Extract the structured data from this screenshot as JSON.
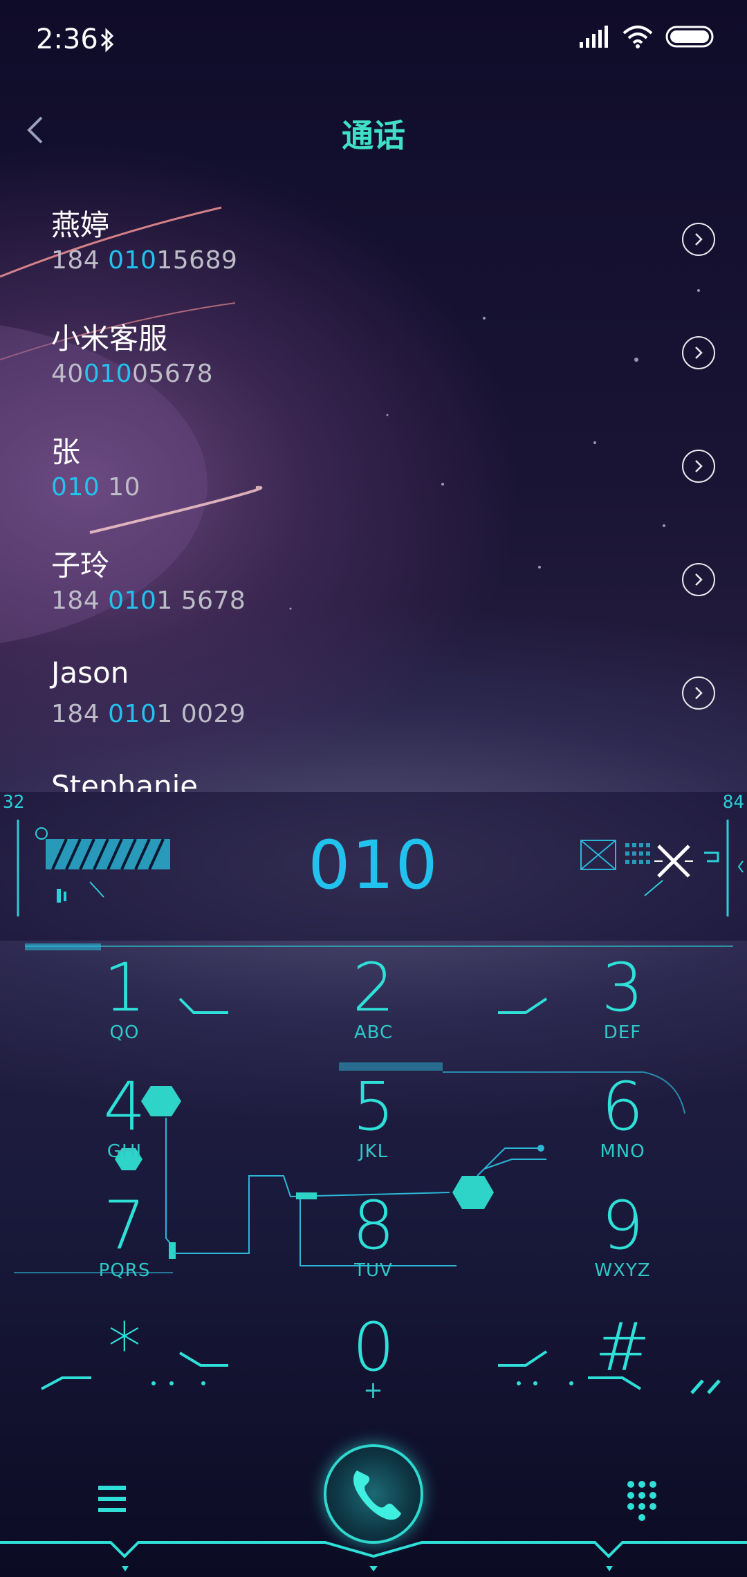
{
  "status_bar": {
    "time": "2:36"
  },
  "header": {
    "title": "通话"
  },
  "calls": [
    {
      "name": "燕婷",
      "number": [
        {
          "t": "184 ",
          "h": false
        },
        {
          "t": "010",
          "h": true
        },
        {
          "t": "15689",
          "h": false
        }
      ]
    },
    {
      "name": "小米客服",
      "number": [
        {
          "t": "40",
          "h": false
        },
        {
          "t": "010",
          "h": true
        },
        {
          "t": "05678",
          "h": false
        }
      ]
    },
    {
      "name": "张",
      "number": [
        {
          "t": "010",
          "h": true
        },
        {
          "t": " 10",
          "h": false
        }
      ]
    },
    {
      "name": "子玲",
      "number": [
        {
          "t": "184 ",
          "h": false
        },
        {
          "t": "010",
          "h": true
        },
        {
          "t": "1 5678",
          "h": false
        }
      ]
    },
    {
      "name": "Jason",
      "number": [
        {
          "t": "184 ",
          "h": false
        },
        {
          "t": "010",
          "h": true
        },
        {
          "t": "1 0029",
          "h": false
        }
      ]
    },
    {
      "name": "Stephanie",
      "number": []
    }
  ],
  "dialer": {
    "number": "010",
    "corner_left": "32",
    "corner_right": "84"
  },
  "keypad": [
    {
      "digit": "1",
      "letters": "QO"
    },
    {
      "digit": "2",
      "letters": "ABC"
    },
    {
      "digit": "3",
      "letters": "DEF"
    },
    {
      "digit": "4",
      "letters": "GHI"
    },
    {
      "digit": "5",
      "letters": "JKL"
    },
    {
      "digit": "6",
      "letters": "MNO"
    },
    {
      "digit": "7",
      "letters": "PQRS"
    },
    {
      "digit": "8",
      "letters": "TUV"
    },
    {
      "digit": "9",
      "letters": "WXYZ"
    },
    {
      "digit": "*",
      "letters": ""
    },
    {
      "digit": "0",
      "letters": "+"
    },
    {
      "digit": "#",
      "letters": ""
    }
  ],
  "colors": {
    "accent": "#2ee0d8",
    "highlight": "#23c2ee",
    "title": "#3fe0c6"
  },
  "icons": [
    "bluetooth-icon",
    "signal-icon",
    "wifi-icon",
    "battery-icon",
    "back-icon",
    "chevron-right-icon",
    "clear-icon",
    "menu-icon",
    "phone-icon",
    "dialpad-icon"
  ]
}
